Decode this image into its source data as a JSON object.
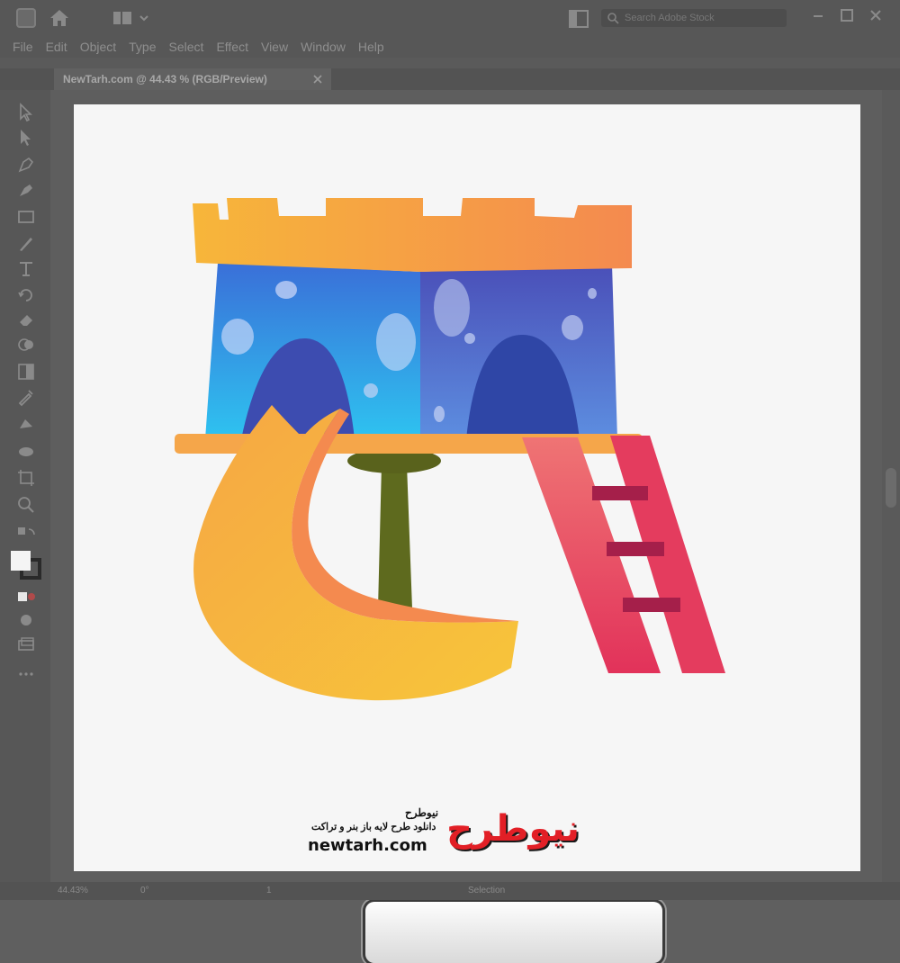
{
  "app": {
    "menu": [
      "File",
      "Edit",
      "Object",
      "Type",
      "Select",
      "Effect",
      "View",
      "Window",
      "Help"
    ]
  },
  "search": {
    "placeholder": "Search Adobe Stock"
  },
  "document": {
    "tab_title": "NewTarh.com @ 44.43 % (RGB/Preview)"
  },
  "status": {
    "zoom": "44.43%",
    "rotation": "0°",
    "page": "1",
    "tool": "Selection"
  },
  "watermark": {
    "brand_fa": "نیوطرح",
    "tagline_fa": "دانلود طرح لایه باز بنر و تراکت",
    "url": "newtarh.com",
    "logo_text": "نیوطرح"
  },
  "colors": {
    "chrome": "#575757",
    "artboard": "#f6f6f6",
    "tower_orange": "#f6a53a",
    "tower_blue": "#3f7ee6",
    "slide_yellow": "#f7b733",
    "ladder_pink": "#e63d5c",
    "pole_olive": "#6b7422",
    "logo_red": "#e21f26"
  },
  "icons": [
    "illustrator-logo-icon",
    "home-icon",
    "workspace-icon",
    "arrange-icon",
    "search-icon",
    "minimize-icon",
    "maximize-icon",
    "close-icon"
  ]
}
